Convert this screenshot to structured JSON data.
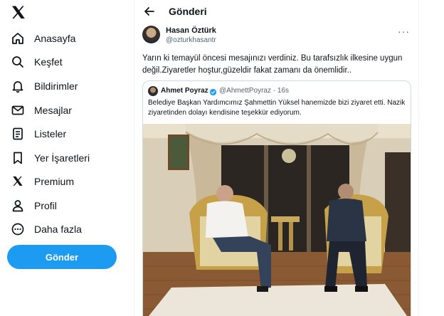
{
  "nav": {
    "items": [
      {
        "id": "home",
        "label": "Anasayfa",
        "icon": "home-icon"
      },
      {
        "id": "explore",
        "label": "Keşfet",
        "icon": "search-icon"
      },
      {
        "id": "notifications",
        "label": "Bildirimler",
        "icon": "bell-icon"
      },
      {
        "id": "messages",
        "label": "Mesajlar",
        "icon": "mail-icon"
      },
      {
        "id": "lists",
        "label": "Listeler",
        "icon": "list-icon"
      },
      {
        "id": "bookmarks",
        "label": "Yer İşaretleri",
        "icon": "bookmark-icon"
      },
      {
        "id": "premium",
        "label": "Premium",
        "icon": "x-logo-icon"
      },
      {
        "id": "profile",
        "label": "Profil",
        "icon": "person-icon"
      },
      {
        "id": "more",
        "label": "Daha fazla",
        "icon": "more-circle-icon"
      }
    ],
    "post_button": "Gönder"
  },
  "header": {
    "title": "Gönderi"
  },
  "tweet": {
    "author_name": "Hasan Öztürk",
    "author_handle": "@ozturkhasantr",
    "text": "Yarın ki temayül öncesi mesajınızı verdiniz. Bu tarafsızlık ilkesine uygun değil.Ziyaretler hoştur,güzeldir fakat zamanı da önemlidir..",
    "more": "···"
  },
  "quote": {
    "author_name": "Ahmet Poyraz",
    "author_handle": "@AhmettPoyraz",
    "time": "16s",
    "text": "Belediye Başkan Yardımcımız Şahmettin Yüksel hanemizde bizi ziyaret etti. Nazik ziyaretinden dolayı kendisine teşekkür ediyorum."
  },
  "colors": {
    "accent": "#1d9bf0",
    "text_primary": "#0f1419",
    "text_secondary": "#536471",
    "border": "#cfd9de"
  }
}
